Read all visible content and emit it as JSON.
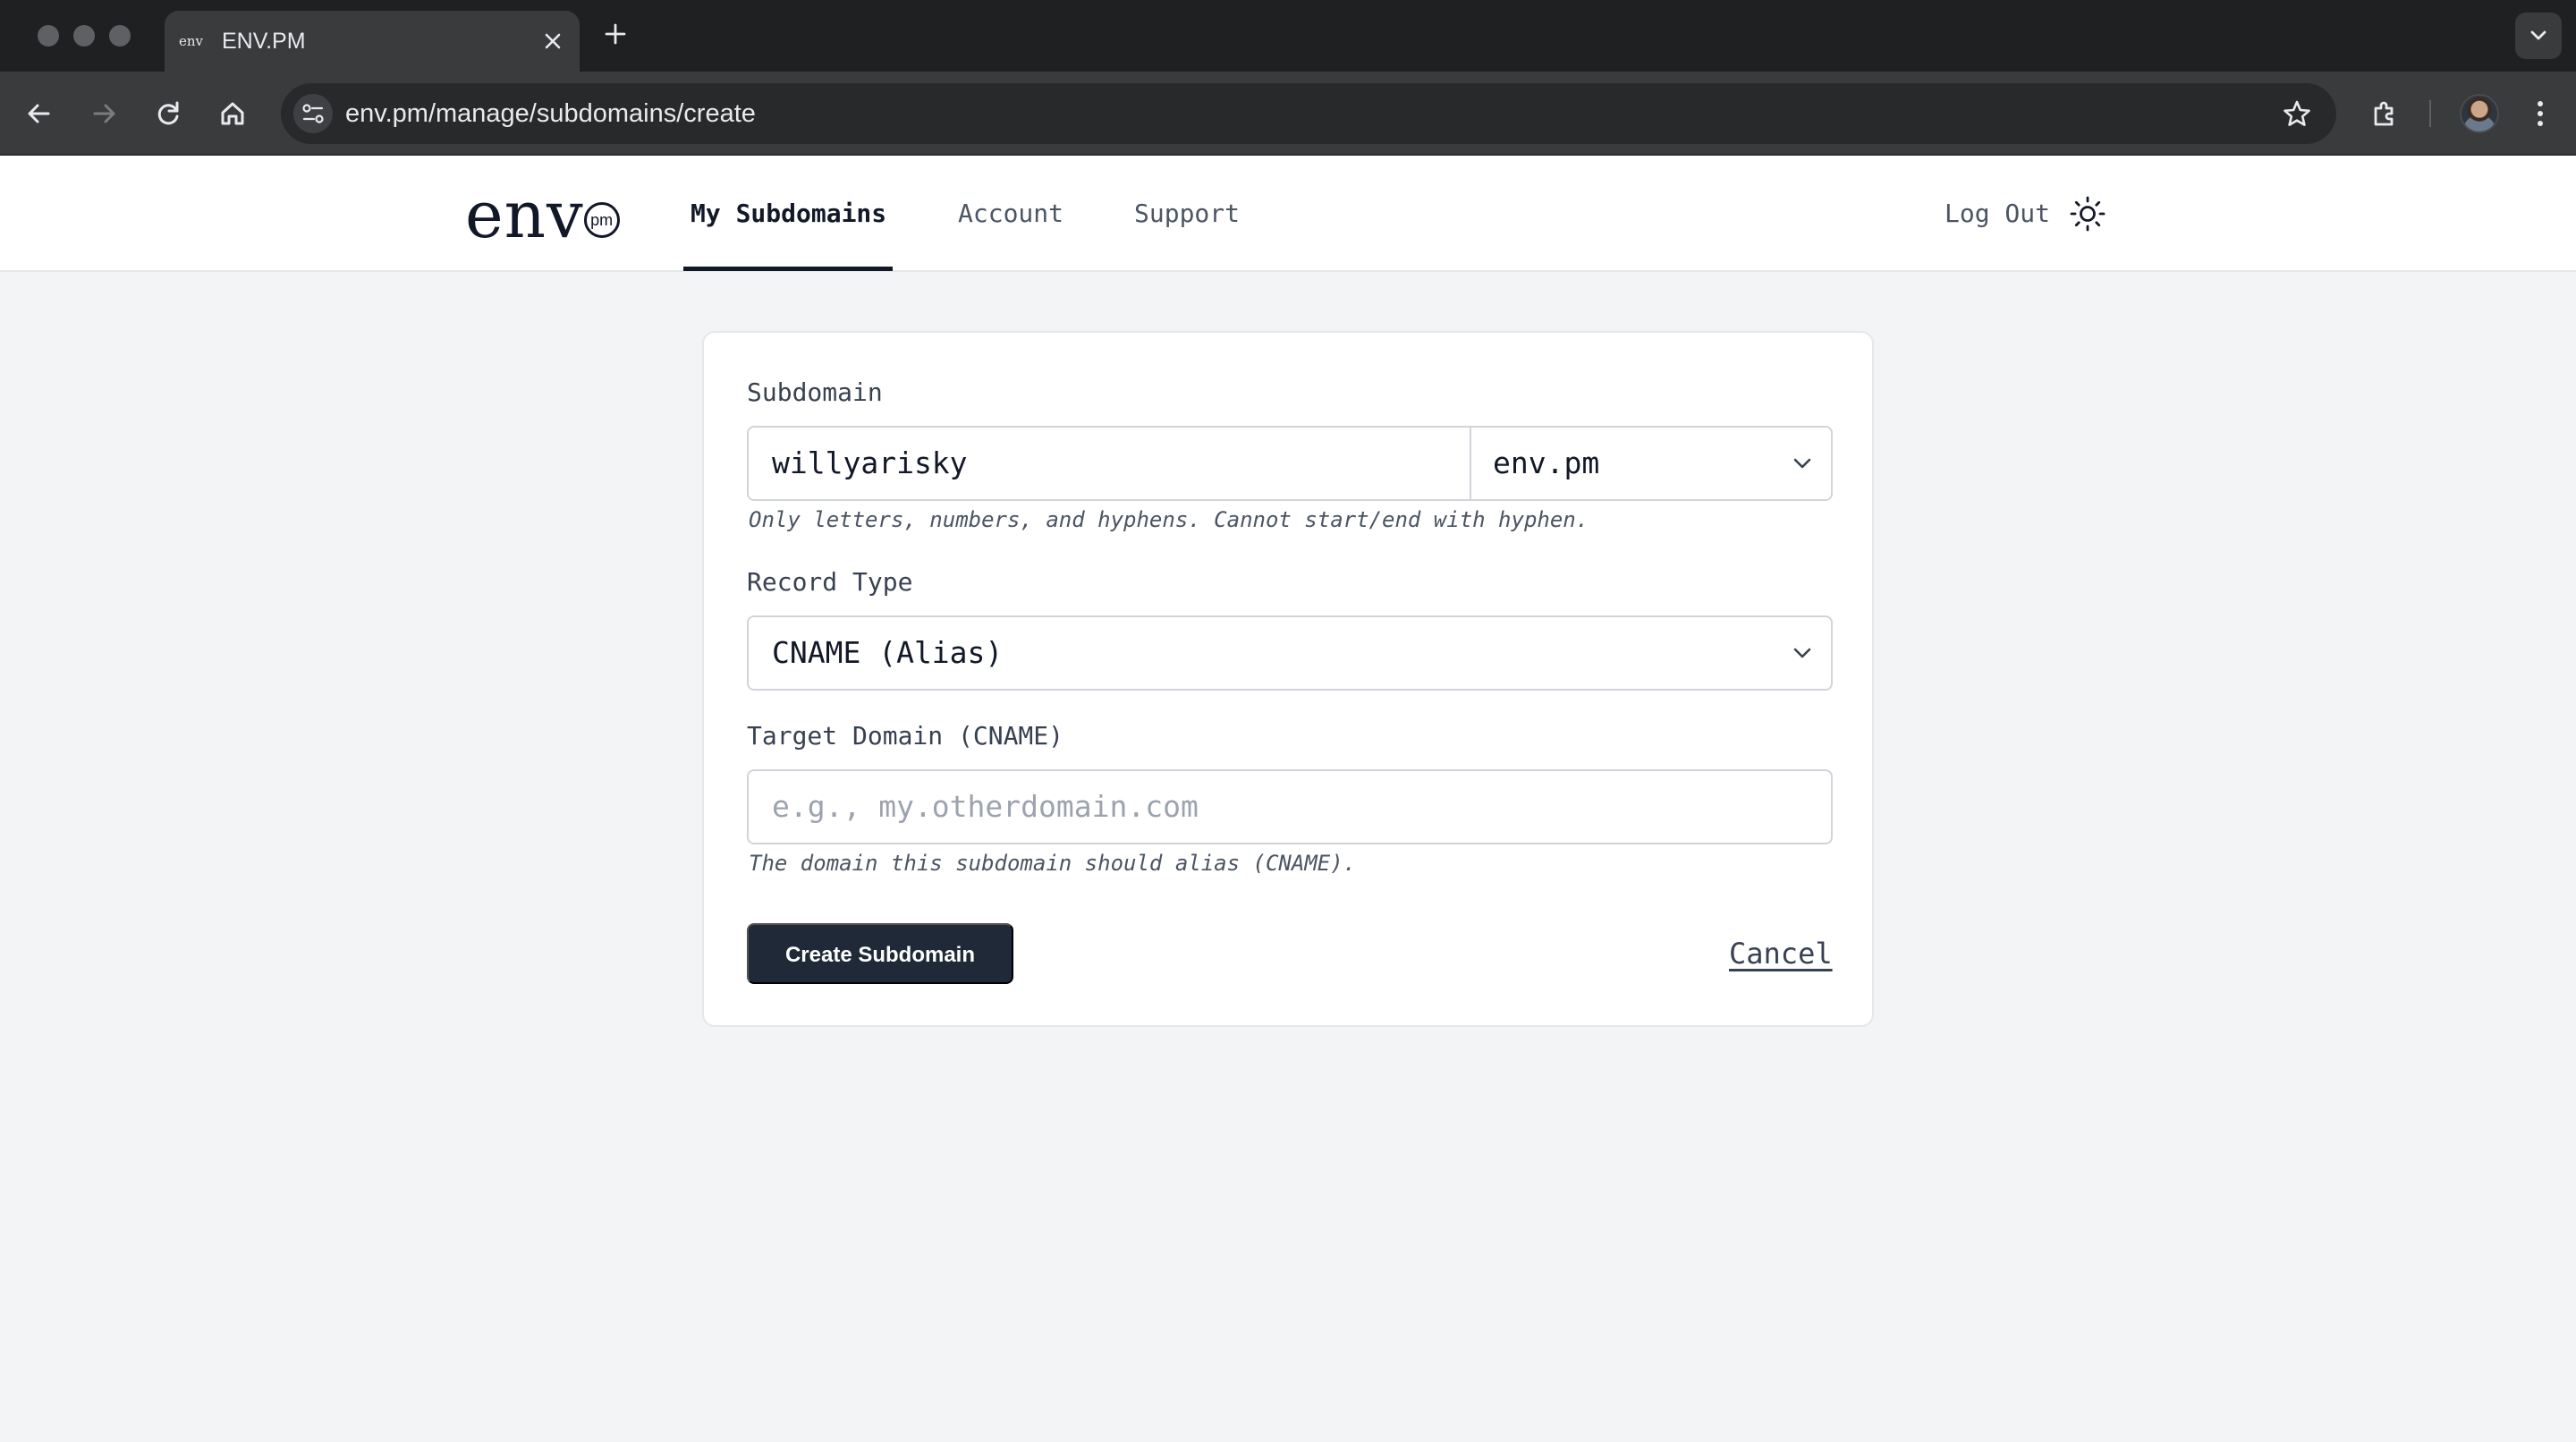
{
  "browser": {
    "tab_title": "ENV.PM",
    "tab_favicon_text": "env",
    "url": "env.pm/manage/subdomains/create"
  },
  "site": {
    "logo_text": "env",
    "logo_badge": "pm",
    "nav": [
      {
        "label": "My Subdomains",
        "active": true
      },
      {
        "label": "Account",
        "active": false
      },
      {
        "label": "Support",
        "active": false
      }
    ],
    "logout_label": "Log Out"
  },
  "form": {
    "subdomain_label": "Subdomain",
    "subdomain_value": "willyarisky",
    "domain_selected": "env.pm",
    "subdomain_hint": "Only letters, numbers, and hyphens. Cannot start/end with hyphen.",
    "record_type_label": "Record Type",
    "record_type_selected": "CNAME (Alias)",
    "target_label": "Target Domain (CNAME)",
    "target_placeholder": "e.g., my.otherdomain.com",
    "target_hint": "The domain this subdomain should alias (CNAME).",
    "create_label": "Create Subdomain",
    "cancel_label": "Cancel"
  }
}
